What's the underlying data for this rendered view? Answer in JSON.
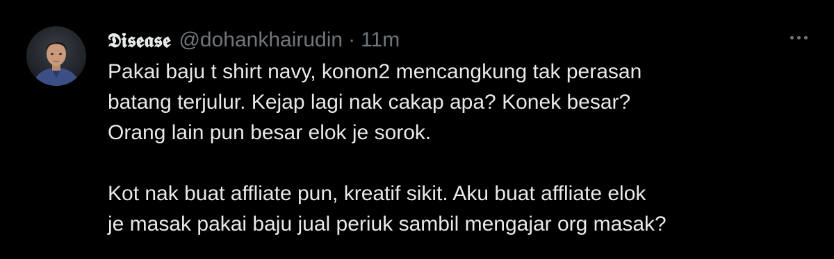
{
  "tweet": {
    "display_name": "𝕯𝖎𝖘𝖊𝖆𝖘𝖊",
    "handle": "@dohankhairudin",
    "separator": "·",
    "time": "11m",
    "more_icon": "more-horizontal-icon",
    "paragraph1": [
      "Pakai baju t shirt navy, konon2 mencangkung tak perasan",
      "batang terjulur. Kejap lagi nak cakap apa? Konek besar?",
      "Orang lain pun besar elok je sorok."
    ],
    "paragraph2": [
      "Kot nak buat affliate pun, kreatif sikit. Aku buat affliate elok",
      "je masak pakai baju jual periuk sambil mengajar org masak?"
    ]
  },
  "colors": {
    "background": "#000000",
    "primary_text": "#e7e9ea",
    "secondary_text": "#71767b"
  }
}
